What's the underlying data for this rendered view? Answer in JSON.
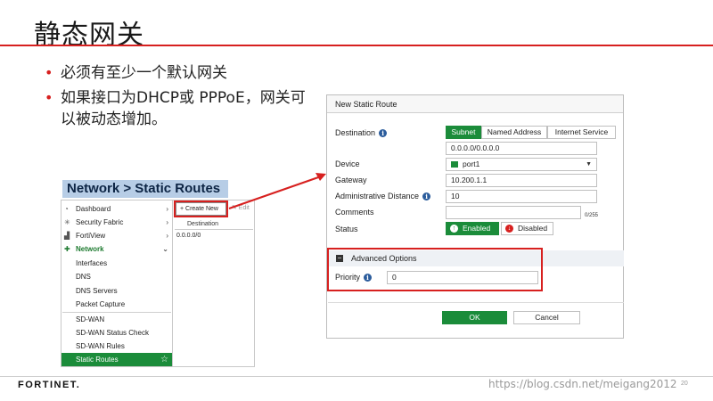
{
  "slide": {
    "title": "静态网关",
    "bullets": [
      "必须有至少一个默认网关",
      "如果接口为DHCP或 PPPoE，网关可以被动态增加。"
    ]
  },
  "nav": {
    "header": "Network > Static Routes",
    "items": [
      {
        "label": "Dashboard",
        "icon": "dashboard-icon",
        "chevron": "›"
      },
      {
        "label": "Security Fabric",
        "icon": "fabric-icon",
        "chevron": "›"
      },
      {
        "label": "FortiView",
        "icon": "chart-icon",
        "chevron": "›"
      },
      {
        "label": "Network",
        "icon": "network-icon",
        "chevron": "⌄"
      },
      {
        "label": "Interfaces"
      },
      {
        "label": "DNS"
      },
      {
        "label": "DNS Servers"
      },
      {
        "label": "Packet Capture"
      },
      {
        "label": "SD-WAN"
      },
      {
        "label": "SD-WAN Status Check"
      },
      {
        "label": "SD-WAN Rules"
      },
      {
        "label": "Static Routes",
        "icon": "star-icon"
      }
    ]
  },
  "list": {
    "create_new": "+ Create New",
    "edit": "✎ Edit",
    "column_header": "Destination",
    "rows": [
      "0.0.0.0/0"
    ]
  },
  "dialog": {
    "title": "New Static Route",
    "destination_label": "Destination",
    "destination_tabs": [
      "Subnet",
      "Named Address",
      "Internet Service"
    ],
    "destination_value": "0.0.0.0/0.0.0.0",
    "device_label": "Device",
    "device_value": "port1",
    "gateway_label": "Gateway",
    "gateway_value": "10.200.1.1",
    "admin_distance_label": "Administrative Distance",
    "admin_distance_value": "10",
    "comments_label": "Comments",
    "comments_counter": "0/255",
    "status_label": "Status",
    "status_enabled": "Enabled",
    "status_disabled": "Disabled",
    "advanced_label": "Advanced Options",
    "priority_label": "Priority",
    "priority_value": "0",
    "ok_label": "OK",
    "cancel_label": "Cancel"
  },
  "footer": {
    "brand": "FORTINET.",
    "watermark": "https://blog.csdn.net/meigang2012",
    "page_number": "20"
  },
  "colors": {
    "accent_red": "#d7201f",
    "fortinet_green": "#1b8c3a",
    "header_blue": "#b7cde6"
  }
}
